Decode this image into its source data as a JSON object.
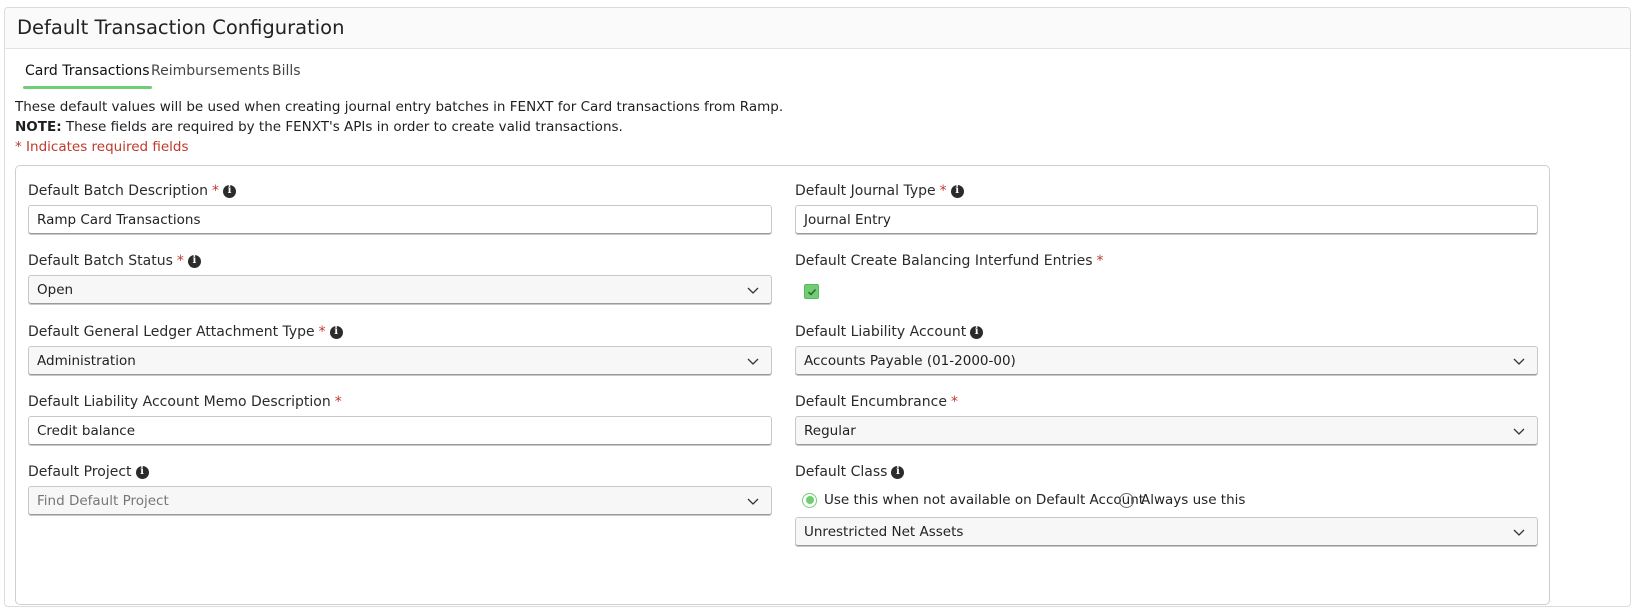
{
  "panel": {
    "title": "Default Transaction Configuration"
  },
  "tabs": [
    {
      "label": "Card Transactions",
      "active": true
    },
    {
      "label": "Reimbursements",
      "active": false
    },
    {
      "label": "Bills",
      "active": false
    }
  ],
  "intro": {
    "line1": "These default values will be used when creating journal entry batches in FENXT for Card transactions from Ramp.",
    "note_label": "NOTE:",
    "note_text": " These fields are required by the FENXT's APIs in order to create valid transactions.",
    "required_text": "* Indicates required fields"
  },
  "form": {
    "batch_description": {
      "label": "Default Batch Description",
      "value": "Ramp Card Transactions"
    },
    "journal_type": {
      "label": "Default Journal Type",
      "value": "Journal Entry"
    },
    "batch_status": {
      "label": "Default Batch Status",
      "value": "Open"
    },
    "balancing_entries": {
      "label": "Default Create Balancing Interfund Entries",
      "checked": true
    },
    "gl_attachment_type": {
      "label": "Default General Ledger Attachment Type",
      "value": "Administration"
    },
    "liability_account": {
      "label": "Default Liability Account",
      "value": "Accounts Payable (01-2000-00)"
    },
    "liability_memo": {
      "label": "Default Liability Account Memo Description",
      "value": "Credit balance"
    },
    "encumbrance": {
      "label": "Default Encumbrance",
      "value": "Regular"
    },
    "project": {
      "label": "Default Project",
      "placeholder": "Find Default Project"
    },
    "class": {
      "label": "Default Class",
      "option_1": "Use this when not available on Default Account",
      "option_2": "Always use this",
      "selected_option": 1,
      "value": "Unrestricted Net Assets"
    }
  },
  "required_marker": "*",
  "colors": {
    "accent": "#6fce73",
    "required": "#c0392b"
  }
}
